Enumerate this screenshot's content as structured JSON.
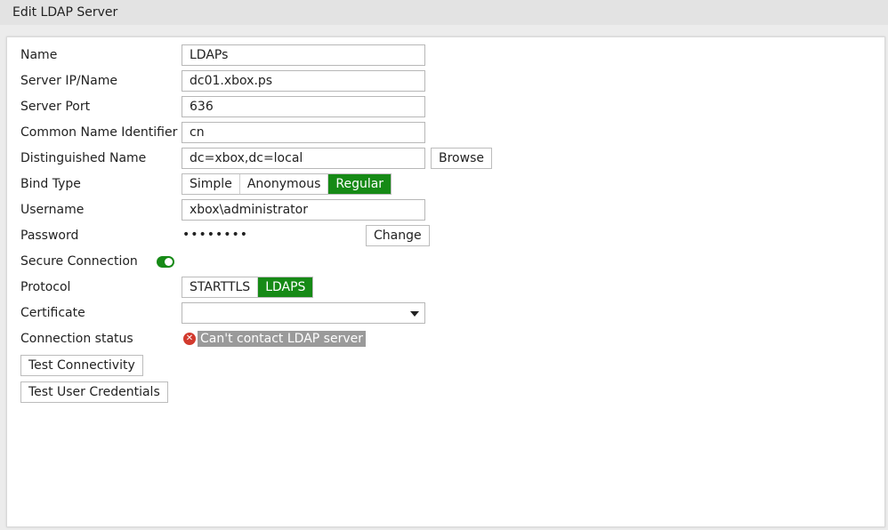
{
  "title": "Edit LDAP Server",
  "fields": {
    "name": {
      "label": "Name",
      "value": "LDAPs"
    },
    "server_ip": {
      "label": "Server IP/Name",
      "value": "dc01.xbox.ps"
    },
    "server_port": {
      "label": "Server Port",
      "value": "636"
    },
    "cn_identifier": {
      "label": "Common Name Identifier",
      "value": "cn"
    },
    "distinguished_name": {
      "label": "Distinguished Name",
      "value": "dc=xbox,dc=local",
      "browse_label": "Browse"
    },
    "bind_type": {
      "label": "Bind Type",
      "options": [
        "Simple",
        "Anonymous",
        "Regular"
      ],
      "selected": "Regular"
    },
    "username": {
      "label": "Username",
      "value": "xbox\\administrator"
    },
    "password": {
      "label": "Password",
      "masked": "••••••••",
      "change_label": "Change"
    },
    "secure_connection": {
      "label": "Secure Connection",
      "enabled": true
    },
    "protocol": {
      "label": "Protocol",
      "options": [
        "STARTTLS",
        "LDAPS"
      ],
      "selected": "LDAPS"
    },
    "certificate": {
      "label": "Certificate",
      "value": ""
    },
    "connection_status": {
      "label": "Connection status",
      "message": "Can't contact LDAP server",
      "icon": "error-icon"
    }
  },
  "actions": {
    "test_connectivity": "Test Connectivity",
    "test_user_credentials": "Test User Credentials"
  },
  "colors": {
    "accent": "#168a16",
    "error": "#d23a2e"
  }
}
